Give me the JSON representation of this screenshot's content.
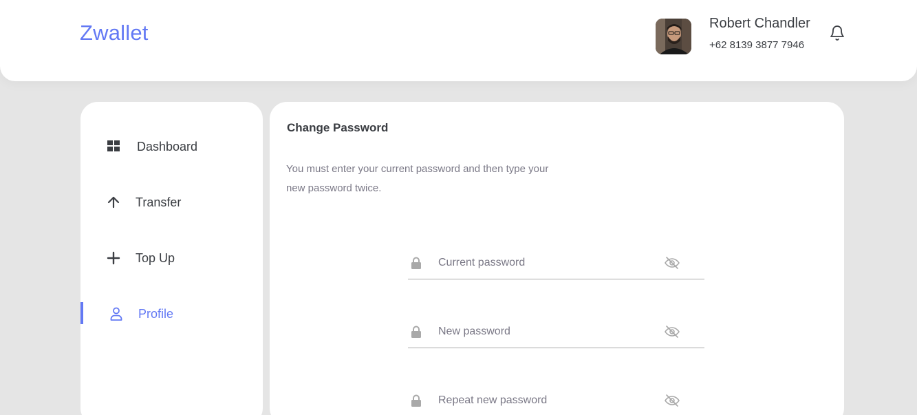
{
  "header": {
    "brand": "Zwallet",
    "user": {
      "name": "Robert Chandler",
      "phone": "+62 8139 3877 7946"
    }
  },
  "sidebar": {
    "items": [
      {
        "label": "Dashboard",
        "icon": "dashboard-grid-icon",
        "active": false
      },
      {
        "label": "Transfer",
        "icon": "arrow-up-icon",
        "active": false
      },
      {
        "label": "Top Up",
        "icon": "plus-icon",
        "active": false
      },
      {
        "label": "Profile",
        "icon": "user-icon",
        "active": true
      }
    ]
  },
  "main": {
    "title": "Change Password",
    "description": "You must enter your current password and then type your new password twice.",
    "fields": {
      "current": {
        "placeholder": "Current password",
        "value": ""
      },
      "new": {
        "placeholder": "New password",
        "value": ""
      },
      "repeat": {
        "placeholder": "Repeat new password",
        "value": ""
      }
    }
  },
  "colors": {
    "accent": "#6379f4",
    "text": "#3a3d42",
    "muted": "#7a7886",
    "background": "#e5e5e5",
    "icon_muted": "#a9a9a9"
  }
}
